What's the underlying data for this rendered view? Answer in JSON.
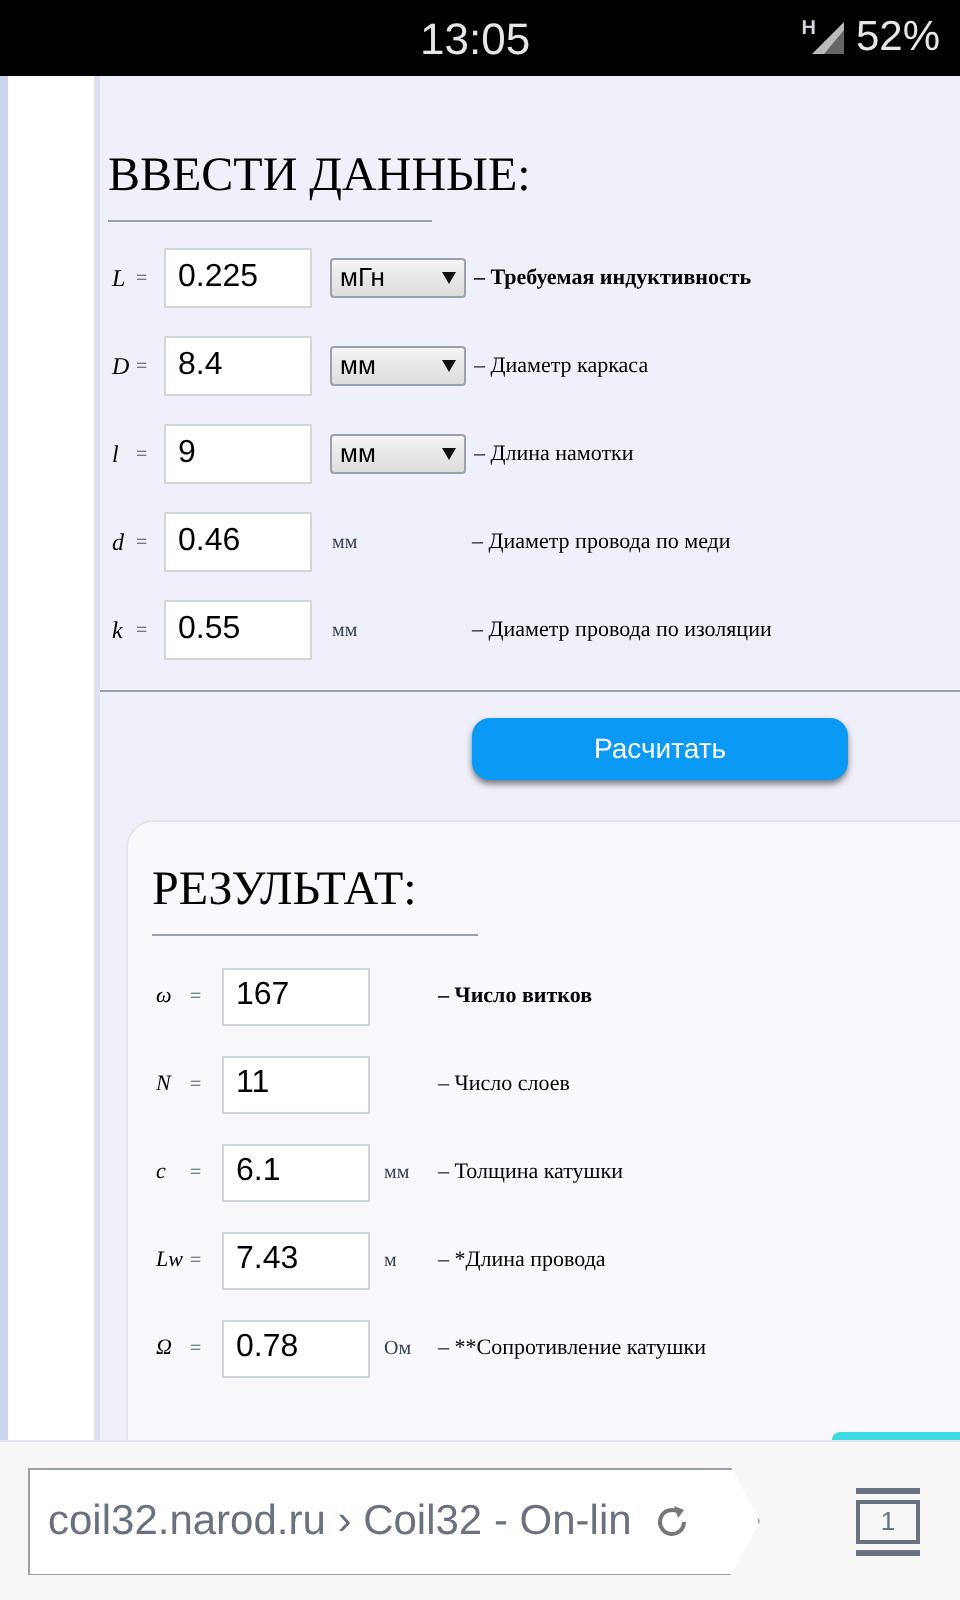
{
  "status_bar": {
    "time": "13:05",
    "network": "H",
    "battery": "52%"
  },
  "input_section": {
    "title": "ВВЕСТИ ДАННЫЕ:",
    "rows": [
      {
        "kind": "select",
        "symbol": "L",
        "operator": "=",
        "value": "0.225",
        "unit": "мГн",
        "description": "– Требуемая индуктивность",
        "bold": true
      },
      {
        "kind": "select",
        "symbol": "D",
        "operator": "=",
        "value": "8.4",
        "unit": "мм",
        "description": "– Диаметр каркаса",
        "bold": false
      },
      {
        "kind": "select",
        "symbol": "l",
        "operator": "=",
        "value": "9",
        "unit": "мм",
        "description": "– Длина намотки",
        "bold": false
      },
      {
        "kind": "text",
        "symbol": "d",
        "operator": "=",
        "value": "0.46",
        "unit": "мм",
        "description": "– Диаметр провода по меди",
        "bold": false
      },
      {
        "kind": "text",
        "symbol": "k",
        "operator": "=",
        "value": "0.55",
        "unit": "мм",
        "description": "– Диаметр провода по изоляции",
        "bold": false
      }
    ],
    "button": "Расчитать"
  },
  "result_section": {
    "title": "РЕЗУЛЬТАТ:",
    "rows": [
      {
        "symbol": "ω",
        "operator": "=",
        "value": "167",
        "description": "– Число витков",
        "bold": true
      },
      {
        "symbol": "N",
        "operator": "=",
        "value": "11",
        "description": "– Число слоев",
        "bold": false
      },
      {
        "symbol": "c",
        "operator": "=",
        "value": "6.1",
        "unit": "мм",
        "description": "– Толщина катушки",
        "bold": false
      },
      {
        "symbol": "Lw",
        "operator": "=",
        "value": "7.43",
        "unit": "м",
        "description": "– *Длина провода",
        "bold": false
      },
      {
        "symbol": "Ω",
        "operator": "=",
        "value": "0.78",
        "unit": "Ом",
        "description": "– **Сопротивление катушки",
        "bold": false
      }
    ]
  },
  "browser_bar": {
    "address": "coil32.narod.ru › Coil32 - On-lin",
    "tab_count": "1"
  }
}
